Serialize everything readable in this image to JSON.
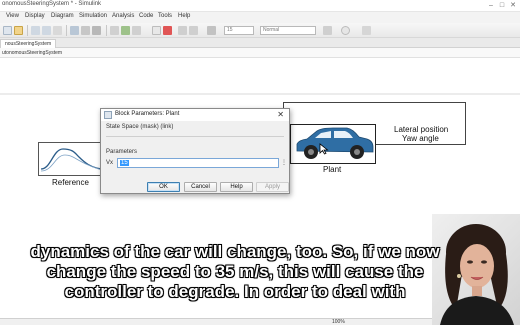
{
  "window": {
    "title": "onomousSteeringSystem * - Simulink"
  },
  "menu": [
    "View",
    "Display",
    "Diagram",
    "Simulation",
    "Analysis",
    "Code",
    "Tools",
    "Help"
  ],
  "toolbar": {
    "stop_time": "15",
    "sim_mode": "Normal"
  },
  "tab": {
    "label": "nousSteeringSystem"
  },
  "breadcrumb": {
    "path": "utonomousSteeringSystem"
  },
  "model": {
    "reference_label": "Reference",
    "plant_label": "Plant",
    "output1": "Lateral position",
    "output2": "Yaw angle"
  },
  "dialog": {
    "title": "Block Parameters: Plant",
    "subtitle": "State Space (mask) (link)",
    "group_label": "Parameters",
    "param_label": "Vx",
    "param_value": "15",
    "buttons": {
      "ok": "OK",
      "cancel": "Cancel",
      "help": "Help",
      "apply": "Apply"
    }
  },
  "status": {
    "zoom": "100%"
  },
  "subtitles": [
    "dynamics of the car will change, too. So, if we now",
    "change the speed to 35 m/s, this will cause the",
    "controller to degrade. In order to deal with"
  ],
  "colors": {
    "car_body": "#2f6ea4",
    "selection": "#3399ff"
  },
  "icons": {
    "window_controls": [
      "minimize-icon",
      "maximize-icon",
      "close-icon"
    ]
  }
}
